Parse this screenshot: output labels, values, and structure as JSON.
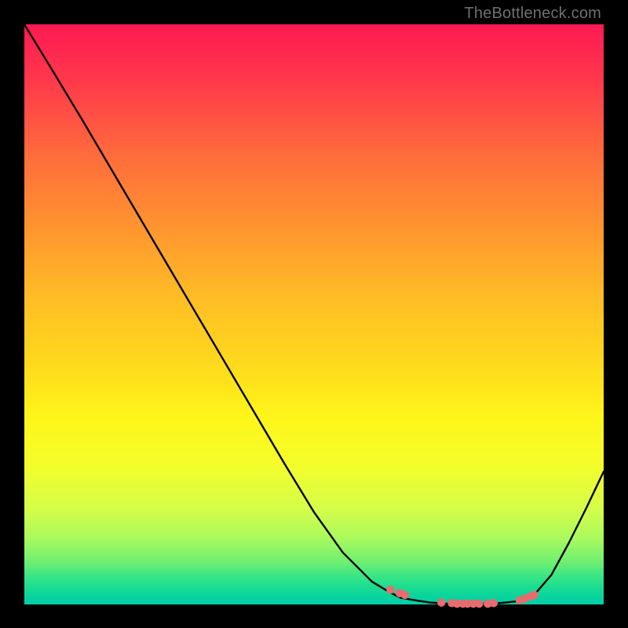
{
  "watermark": {
    "text": "TheBottleneck.com"
  },
  "colors": {
    "curve": "#000000",
    "marker_fill": "#e86b6f",
    "marker_stroke": "#b03c40",
    "bg": "#000000"
  },
  "chart_data": {
    "type": "line",
    "title": "",
    "xlabel": "",
    "ylabel": "",
    "x": [
      0.0,
      0.05,
      0.1,
      0.15,
      0.2,
      0.25,
      0.3,
      0.35,
      0.4,
      0.45,
      0.5,
      0.55,
      0.6,
      0.63,
      0.65,
      0.68,
      0.7,
      0.73,
      0.76,
      0.79,
      0.82,
      0.85,
      0.88,
      0.91,
      0.94,
      0.97,
      1.0
    ],
    "values": [
      1.0,
      0.918,
      0.835,
      0.75,
      0.665,
      0.58,
      0.495,
      0.41,
      0.325,
      0.24,
      0.158,
      0.088,
      0.038,
      0.02,
      0.01,
      0.005,
      0.002,
      0.0,
      0.0,
      0.0,
      0.001,
      0.004,
      0.015,
      0.05,
      0.105,
      0.165,
      0.228
    ],
    "xlim": [
      0,
      1
    ],
    "ylim": [
      0,
      1
    ],
    "markers_x": [
      0.632,
      0.648,
      0.657,
      0.72,
      0.738,
      0.747,
      0.757,
      0.765,
      0.775,
      0.785,
      0.8,
      0.81,
      0.855,
      0.865,
      0.875,
      0.88
    ],
    "markers_y": [
      0.024,
      0.018,
      0.015,
      0.002,
      0.001,
      0.0,
      0.0,
      0.0,
      0.0,
      0.0,
      0.0,
      0.001,
      0.006,
      0.009,
      0.013,
      0.015
    ],
    "gradient_stops": [
      {
        "t": 0.0,
        "color": "#ff1a53"
      },
      {
        "t": 0.1,
        "color": "#ff3a4b"
      },
      {
        "t": 0.22,
        "color": "#ff6a3c"
      },
      {
        "t": 0.35,
        "color": "#ff9530"
      },
      {
        "t": 0.48,
        "color": "#febf24"
      },
      {
        "t": 0.6,
        "color": "#fedd1c"
      },
      {
        "t": 0.68,
        "color": "#fef61a"
      },
      {
        "t": 0.76,
        "color": "#f4fd2a"
      },
      {
        "t": 0.84,
        "color": "#d4fd4a"
      },
      {
        "t": 0.89,
        "color": "#a8f95e"
      },
      {
        "t": 0.93,
        "color": "#6eef72"
      },
      {
        "t": 0.96,
        "color": "#2fe389"
      },
      {
        "t": 0.985,
        "color": "#0dd69a"
      },
      {
        "t": 1.0,
        "color": "#02cfa5"
      }
    ]
  }
}
